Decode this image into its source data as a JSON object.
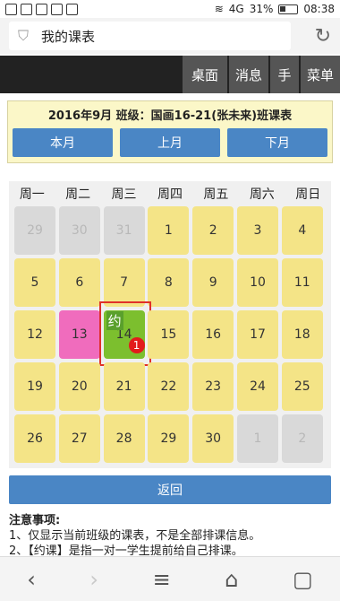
{
  "status_bar": {
    "network": "4G",
    "battery": "31%",
    "time": "08:38"
  },
  "browser": {
    "url_title": "我的课表",
    "shield_icon": "shield-icon",
    "reload_icon": "reload-icon"
  },
  "nav": {
    "items": [
      "桌面",
      "消息",
      "手",
      "菜单"
    ]
  },
  "header": {
    "title": "2016年9月 班级：国画16-21(张未来)班课表",
    "buttons": [
      "本月",
      "上月",
      "下月"
    ]
  },
  "calendar": {
    "weekdays": [
      "周一",
      "周二",
      "周三",
      "周四",
      "周五",
      "周六",
      "周日"
    ],
    "weeks": [
      [
        {
          "d": "29",
          "t": "other"
        },
        {
          "d": "30",
          "t": "other"
        },
        {
          "d": "31",
          "t": "other"
        },
        {
          "d": "1",
          "t": "cur"
        },
        {
          "d": "2",
          "t": "cur"
        },
        {
          "d": "3",
          "t": "cur"
        },
        {
          "d": "4",
          "t": "cur"
        }
      ],
      [
        {
          "d": "5",
          "t": "cur"
        },
        {
          "d": "6",
          "t": "cur"
        },
        {
          "d": "7",
          "t": "cur"
        },
        {
          "d": "8",
          "t": "cur"
        },
        {
          "d": "9",
          "t": "cur"
        },
        {
          "d": "10",
          "t": "cur"
        },
        {
          "d": "11",
          "t": "cur"
        }
      ],
      [
        {
          "d": "12",
          "t": "cur"
        },
        {
          "d": "13",
          "t": "pink"
        },
        {
          "d": "14",
          "t": "green",
          "tag": "约",
          "badge": "1"
        },
        {
          "d": "15",
          "t": "cur"
        },
        {
          "d": "16",
          "t": "cur"
        },
        {
          "d": "17",
          "t": "cur"
        },
        {
          "d": "18",
          "t": "cur"
        }
      ],
      [
        {
          "d": "19",
          "t": "cur"
        },
        {
          "d": "20",
          "t": "cur"
        },
        {
          "d": "21",
          "t": "cur"
        },
        {
          "d": "22",
          "t": "cur"
        },
        {
          "d": "23",
          "t": "cur"
        },
        {
          "d": "24",
          "t": "cur"
        },
        {
          "d": "25",
          "t": "cur"
        }
      ],
      [
        {
          "d": "26",
          "t": "cur"
        },
        {
          "d": "27",
          "t": "cur"
        },
        {
          "d": "28",
          "t": "cur"
        },
        {
          "d": "29",
          "t": "cur"
        },
        {
          "d": "30",
          "t": "cur"
        },
        {
          "d": "1",
          "t": "other"
        },
        {
          "d": "2",
          "t": "other"
        }
      ]
    ]
  },
  "back_label": "返回",
  "notes": {
    "title": "注意事项:",
    "lines": [
      "1、仅显示当前班级的课表，不是全部排课信息。",
      "2、【约课】是指一对一学生提前给自己排课。"
    ]
  },
  "bottom_nav": [
    "back-icon",
    "forward-icon",
    "menu-icon",
    "home-icon",
    "tabs-icon"
  ],
  "colors": {
    "current": "#f4e487",
    "other": "#d9d9d9",
    "pink": "#f06cbd",
    "green": "#7cbf2e",
    "button": "#4a86c5"
  }
}
